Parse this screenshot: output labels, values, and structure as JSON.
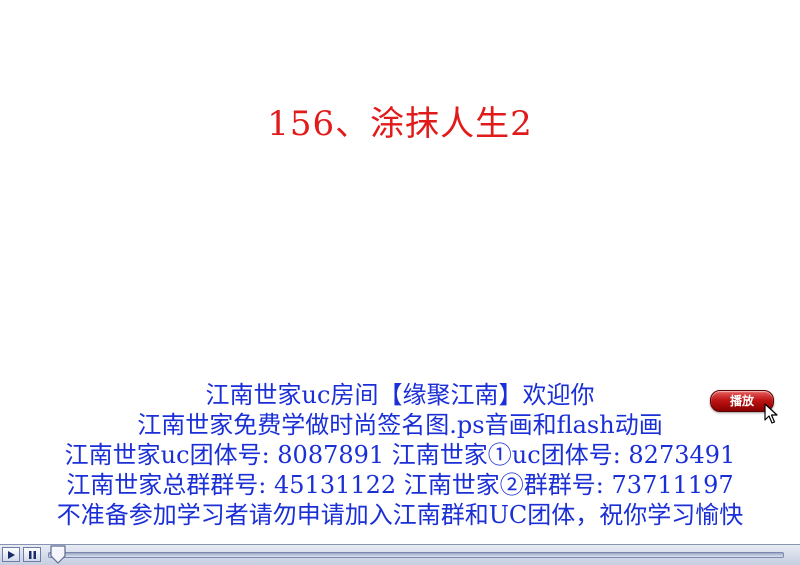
{
  "title": "156、涂抹人生2",
  "info_lines": [
    "江南世家uc房间【缘聚江南】欢迎你",
    "江南世家免费学做时尚签名图.ps音画和flash动画",
    "江南世家uc团体号: 8087891 江南世家①uc团体号: 8273491",
    "江南世家总群群号: 45131122    江南世家②群群号: 73711197",
    "不准备参加学习者请勿申请加入江南群和UC团体，祝你学习愉快"
  ],
  "play_button_label": "播放",
  "player": {
    "progress": 0.0
  },
  "colors": {
    "title": "#e11a1a",
    "info_text": "#1a2fd6",
    "play_button": "#c01515"
  },
  "icons": {
    "cursor": "mouse-pointer-icon",
    "play": "play-icon",
    "pause": "pause-icon",
    "scrubber": "scrubber-thumb-icon"
  }
}
